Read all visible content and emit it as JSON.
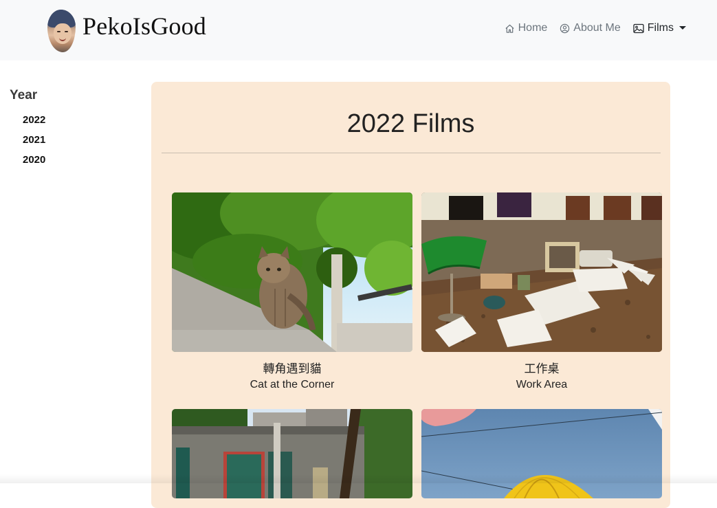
{
  "brand": {
    "name": "PekoIsGood"
  },
  "nav": {
    "items": [
      {
        "label": "Home",
        "icon": "home-icon"
      },
      {
        "label": "About Me",
        "icon": "user-circle-icon"
      },
      {
        "label": "Films",
        "icon": "images-icon",
        "active": true,
        "dropdown": true
      }
    ]
  },
  "sidebar": {
    "heading": "Year",
    "years": [
      "2022",
      "2021",
      "2020"
    ]
  },
  "main": {
    "title": "2022 Films",
    "films": [
      {
        "title_zh": "轉角遇到貓",
        "title_en": "Cat at the Corner"
      },
      {
        "title_zh": "工作桌",
        "title_en": "Work Area"
      },
      {
        "title_zh": "",
        "title_en": ""
      },
      {
        "title_zh": "",
        "title_en": ""
      }
    ]
  },
  "colors": {
    "navbar_bg": "#f8f9fa",
    "card_bg": "#fbe9d6",
    "nav_muted": "#6c757d",
    "nav_active": "#212529"
  }
}
